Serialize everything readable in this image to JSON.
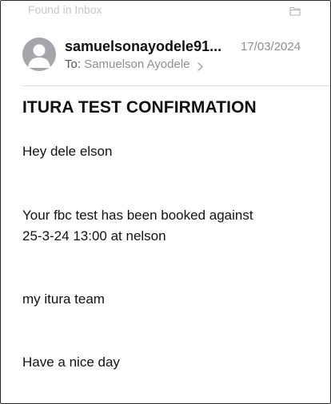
{
  "topbar": {
    "mailbox_label": "Found in Inbox",
    "folder_icon": "folder-icon"
  },
  "message": {
    "sender": "samuelsonayodele91...",
    "date": "17/03/2024",
    "to_prefix": "To:",
    "recipient": "Samuelson Ayodele",
    "subject": "ITURA TEST CONFIRMATION",
    "body": [
      "Hey dele elson",
      "Your fbc test has been booked against",
      "25-3-24 13:00 at nelson",
      "my itura team",
      "Have a nice day"
    ]
  },
  "colors": {
    "avatar_gray": "#a4a6ab",
    "secondary_text": "#8e8e93",
    "faded_text": "#c8c8c8"
  }
}
